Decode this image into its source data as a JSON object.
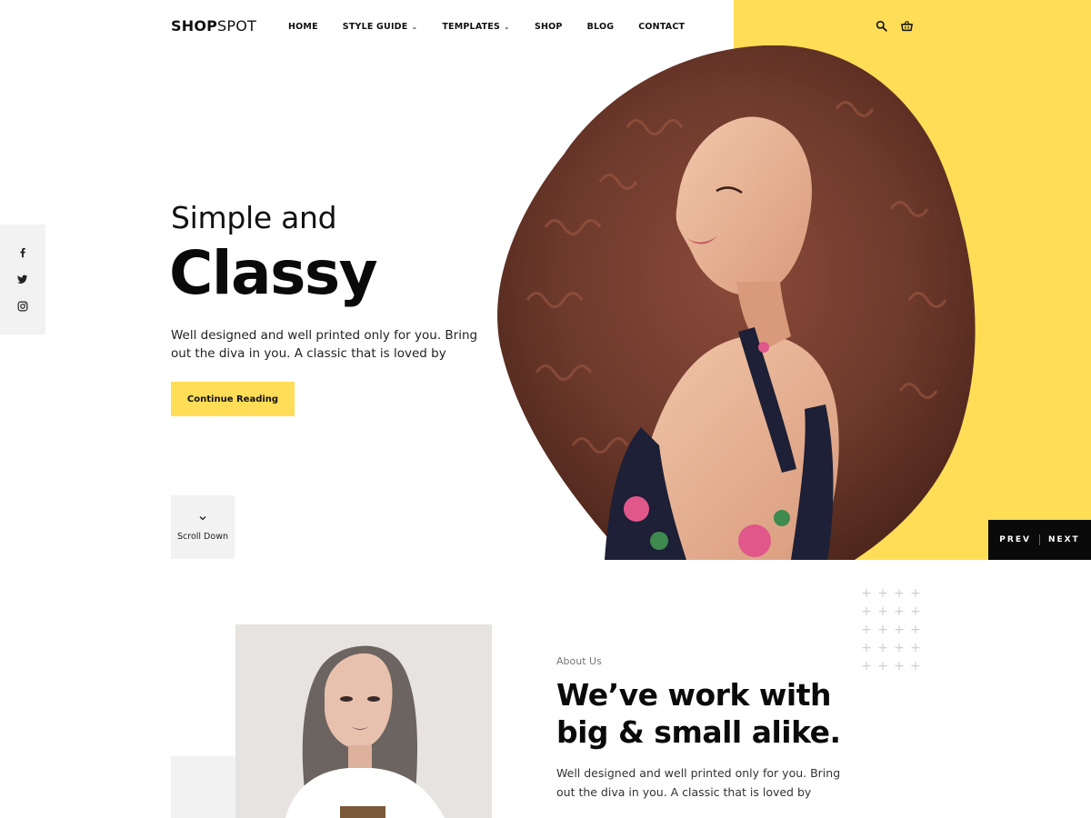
{
  "brand": {
    "logo_bold": "SHOP",
    "logo_light": "SPOT"
  },
  "nav": {
    "items": [
      {
        "label": "HOME",
        "has_dropdown": false
      },
      {
        "label": "STYLE GUIDE",
        "has_dropdown": true
      },
      {
        "label": "TEMPLATES",
        "has_dropdown": true
      },
      {
        "label": "SHOP",
        "has_dropdown": false
      },
      {
        "label": "BLOG",
        "has_dropdown": false
      },
      {
        "label": "CONTACT",
        "has_dropdown": false
      }
    ],
    "icons": [
      "search-icon",
      "basket-icon"
    ]
  },
  "social": [
    "facebook-icon",
    "twitter-icon",
    "instagram-icon"
  ],
  "hero": {
    "subtitle": "Simple and",
    "title": "Classy",
    "description": "Well designed and well printed only for you. Bring out the diva in you. A classic that is loved by",
    "cta_label": "Continue Reading",
    "scroll_label": "Scroll Down"
  },
  "slider": {
    "prev_label": "PREV",
    "next_label": "NEXT"
  },
  "about": {
    "eyebrow": "About Us",
    "title_line1": "We’ve work with",
    "title_line2": "big & small alike.",
    "description": "Well designed and well printed only for you. Bring out the diva in you. A classic that is loved by"
  },
  "colors": {
    "accent": "#ffdd57",
    "dark": "#0a0a0a",
    "panel_gray": "#f2f2f2"
  }
}
